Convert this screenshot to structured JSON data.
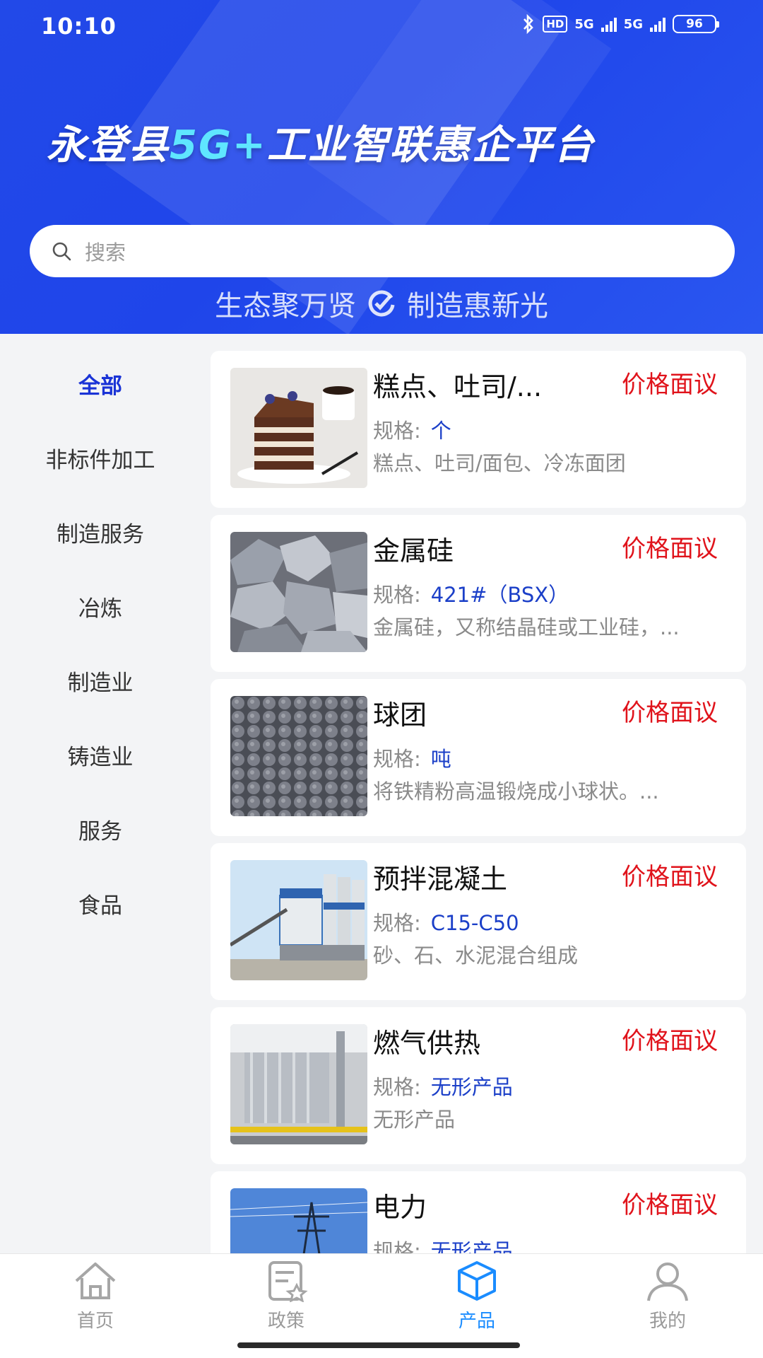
{
  "status_bar": {
    "time": "10:10",
    "net1": "5G",
    "net2": "5G",
    "hd": "HD",
    "battery": "96"
  },
  "header": {
    "title_prefix": "永登县",
    "title_accent": "5G+",
    "title_suffix": "工业智联惠企平台",
    "slogan_left": "生态聚万贤",
    "slogan_right": "制造惠新光"
  },
  "search": {
    "placeholder": "搜索"
  },
  "sidebar": {
    "items": [
      {
        "label": "全部",
        "active": true
      },
      {
        "label": "非标件加工"
      },
      {
        "label": "制造服务"
      },
      {
        "label": "冶炼"
      },
      {
        "label": "制造业"
      },
      {
        "label": "铸造业"
      },
      {
        "label": "服务"
      },
      {
        "label": "食品"
      }
    ]
  },
  "spec_label": "规格:",
  "products": [
    {
      "name": "糕点、吐司/...",
      "price": "价格面议",
      "spec": "个",
      "desc": "糕点、吐司/面包、冷冻面团",
      "image": "cake"
    },
    {
      "name": "金属硅",
      "price": "价格面议",
      "spec": "421#（BSX）",
      "desc": "金属硅，又称结晶硅或工业硅，...",
      "image": "silicon"
    },
    {
      "name": "球团",
      "price": "价格面议",
      "spec": "吨",
      "desc": "将铁精粉高温锻烧成小球状。...",
      "image": "pellets"
    },
    {
      "name": "预拌混凝土",
      "price": "价格面议",
      "spec": "C15-C50",
      "desc": "砂、石、水泥混合组成",
      "image": "concrete-plant"
    },
    {
      "name": "燃气供热",
      "price": "价格面议",
      "spec": "无形产品",
      "desc": "无形产品",
      "image": "gas-heating"
    },
    {
      "name": "电力",
      "price": "价格面议",
      "spec": "无形产品",
      "desc": "",
      "image": "power-tower"
    }
  ],
  "bottom_nav": [
    {
      "label": "首页",
      "icon": "home-icon"
    },
    {
      "label": "政策",
      "icon": "policy-icon"
    },
    {
      "label": "产品",
      "icon": "cube-icon",
      "active": true
    },
    {
      "label": "我的",
      "icon": "user-icon"
    }
  ]
}
